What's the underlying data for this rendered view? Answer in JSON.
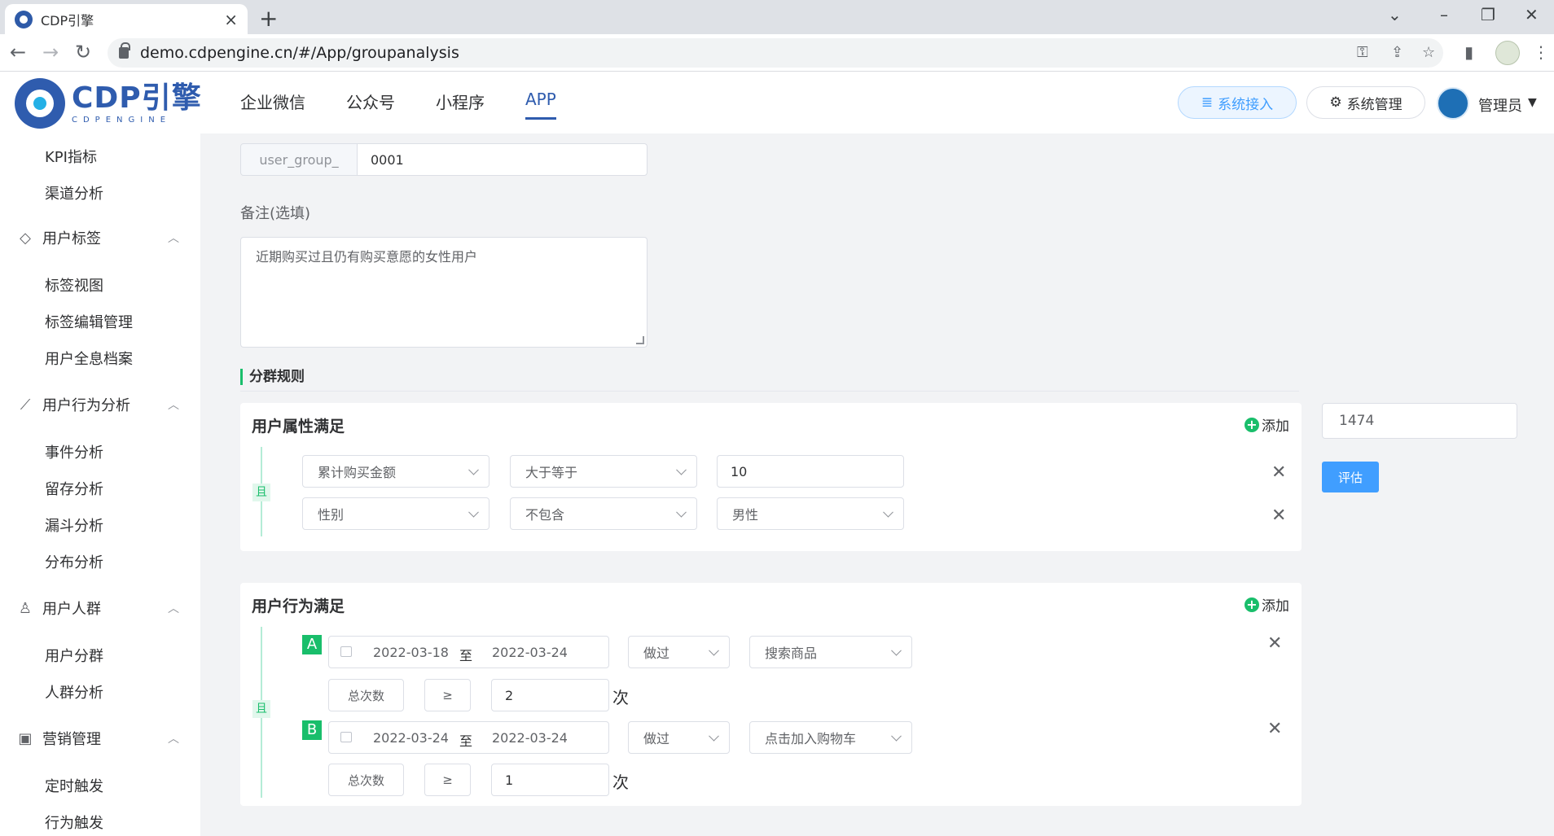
{
  "browser": {
    "tab_title": "CDP引擎",
    "url": "demo.cdpengine.cn/#/App/groupanalysis"
  },
  "header": {
    "logo_main": "CDP引擎",
    "logo_sub": "CDPENGINE",
    "nav": [
      "企业微信",
      "公众号",
      "小程序",
      "APP"
    ],
    "active_nav": "APP",
    "connect_label": "系统接入",
    "manage_label": "系统管理",
    "user_name": "管理员"
  },
  "sidebar": {
    "items": [
      {
        "type": "item",
        "label": "KPI指标"
      },
      {
        "type": "item",
        "label": "渠道分析"
      },
      {
        "type": "group",
        "label": "用户标签",
        "icon": "tag-icon"
      },
      {
        "type": "item",
        "label": "标签视图"
      },
      {
        "type": "item",
        "label": "标签编辑管理"
      },
      {
        "type": "item",
        "label": "用户全息档案"
      },
      {
        "type": "group",
        "label": "用户行为分析",
        "icon": "chart-line-icon"
      },
      {
        "type": "item",
        "label": "事件分析"
      },
      {
        "type": "item",
        "label": "留存分析"
      },
      {
        "type": "item",
        "label": "漏斗分析"
      },
      {
        "type": "item",
        "label": "分布分析"
      },
      {
        "type": "group",
        "label": "用户人群",
        "icon": "users-icon"
      },
      {
        "type": "item",
        "label": "用户分群"
      },
      {
        "type": "item",
        "label": "人群分析"
      },
      {
        "type": "group",
        "label": "营销管理",
        "icon": "marketing-icon"
      },
      {
        "type": "item",
        "label": "定时触发"
      },
      {
        "type": "item",
        "label": "行为触发"
      }
    ]
  },
  "form": {
    "group_prefix": "user_group_",
    "group_id": "0001",
    "remark_label": "备注(选填)",
    "remark_value": "近期购买过且仍有购买意愿的女性用户",
    "rules_title": "分群规则",
    "count_value": "1474",
    "evaluate_label": "评估"
  },
  "attr_card": {
    "title": "用户属性满足",
    "add_label": "添加",
    "and_label": "且",
    "rows": [
      {
        "field": "累计购买金额",
        "op": "大于等于",
        "value": "10"
      },
      {
        "field": "性别",
        "op": "不包含",
        "value": "男性"
      }
    ]
  },
  "behavior_card": {
    "title": "用户行为满足",
    "add_label": "添加",
    "and_label": "且",
    "date_sep": "至",
    "unit": "次",
    "rows": [
      {
        "letter": "A",
        "start": "2022-03-18",
        "end": "2022-03-24",
        "did": "做过",
        "event": "搜索商品",
        "metric": "总次数",
        "cmp": "≥",
        "times": "2"
      },
      {
        "letter": "B",
        "start": "2022-03-24",
        "end": "2022-03-24",
        "did": "做过",
        "event": "点击加入购物车",
        "metric": "总次数",
        "cmp": "≥",
        "times": "1"
      }
    ]
  },
  "colors": {
    "brand": "#2f5cae",
    "accent_green": "#19be6b",
    "primary_button": "#409eff"
  }
}
